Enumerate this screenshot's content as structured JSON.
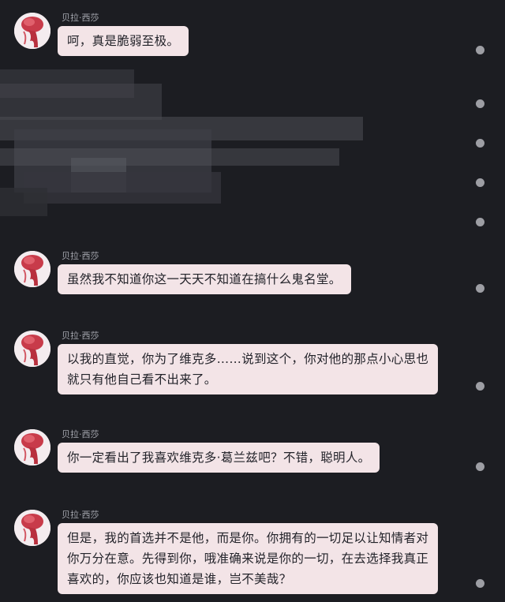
{
  "messages": [
    {
      "sender": "贝拉·西莎",
      "text": "呵，真是脆弱至极。"
    },
    {
      "sender": "贝拉·西莎",
      "text": "虽然我不知道你这一天天不知道在搞什么鬼名堂。"
    },
    {
      "sender": "贝拉·西莎",
      "text": "以我的直觉，你为了维克多……说到这个，你对他的那点小心思也\n就只有他自己看不出来了。"
    },
    {
      "sender": "贝拉·西莎",
      "text": "你一定看出了我喜欢维克多·葛兰兹吧？不错，聪明人。"
    },
    {
      "sender": "贝拉·西莎",
      "text": "但是，我的首选并不是他，而是你。你拥有的一切足以让知情者对\n你万分在意。先得到你，哦准确来说是你的一切，在去选择我真正\n喜欢的，你应该也知道是谁，岂不美哉？"
    }
  ],
  "colors": {
    "background": "#1c1d22",
    "bubble": "#f3e4e7",
    "bubble_text": "#23232a",
    "sender_text": "#a7a9b1",
    "dot": "#9d9ea4"
  }
}
